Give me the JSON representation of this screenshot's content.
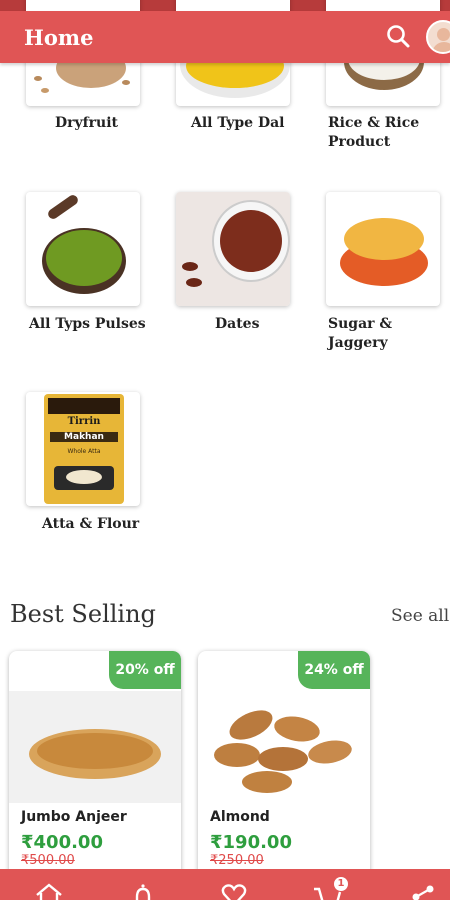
{
  "app_bar": {
    "title": "Home",
    "search_icon": "search-icon",
    "avatar_icon": "user-avatar"
  },
  "categories": [
    {
      "label": "Dryfruit"
    },
    {
      "label": "All Type Dal"
    },
    {
      "label": "Rice & Rice\nProduct"
    },
    {
      "label": "All Typs Pulses"
    },
    {
      "label": "Dates"
    },
    {
      "label": "Sugar &\nJaggery"
    },
    {
      "label": "Atta & Flour"
    }
  ],
  "package": {
    "brand": "Tirrin",
    "product": "Makhan",
    "sub": "Whole Atta"
  },
  "best_selling": {
    "title": "Best Selling",
    "see_all": "See all",
    "products": [
      {
        "name": "Jumbo Anjeer",
        "price": "₹400.00",
        "old_price": "₹500.00",
        "discount": "20% off"
      },
      {
        "name": "Almond",
        "price": "₹190.00",
        "old_price": "₹250.00",
        "discount": "24% off"
      }
    ]
  },
  "bottom_nav": {
    "items": [
      "home-icon",
      "notification-icon",
      "wishlist-icon",
      "cart-icon",
      "share-icon"
    ],
    "cart_badge": "1"
  },
  "colors": {
    "primary": "#e05555",
    "status_bar": "#b73b3b",
    "discount": "#56b45a",
    "price": "#2e9e3e",
    "old_price": "#e04a4a"
  }
}
